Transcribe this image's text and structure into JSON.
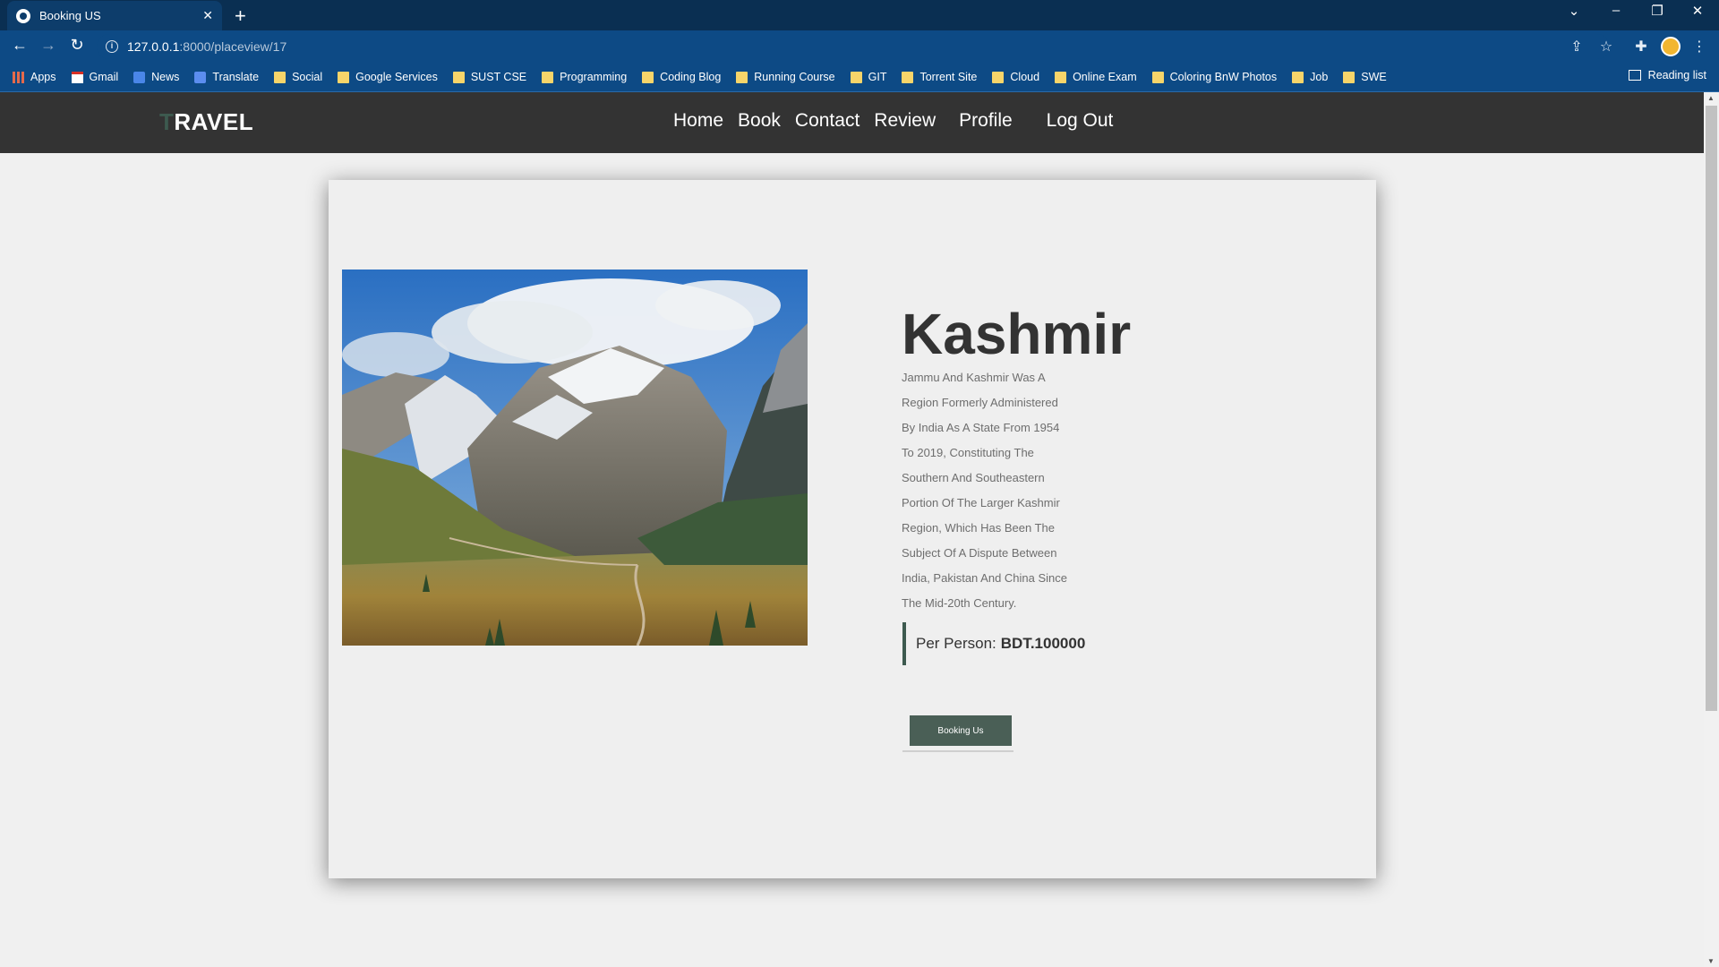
{
  "browser": {
    "tab_title": "Booking US",
    "url_host": "127.0.0.1",
    "url_path": ":8000/placeview/17",
    "bookmarks": [
      {
        "label": "Apps",
        "icon": "apps-icon"
      },
      {
        "label": "Gmail",
        "icon": "gmail-icon"
      },
      {
        "label": "News",
        "icon": "news-icon"
      },
      {
        "label": "Translate",
        "icon": "translate-icon"
      },
      {
        "label": "Social",
        "icon": "folder-icon"
      },
      {
        "label": "Google Services",
        "icon": "folder-icon"
      },
      {
        "label": "SUST CSE",
        "icon": "folder-icon"
      },
      {
        "label": "Programming",
        "icon": "folder-icon"
      },
      {
        "label": "Coding Blog",
        "icon": "folder-icon"
      },
      {
        "label": "Running Course",
        "icon": "folder-icon"
      },
      {
        "label": "GIT",
        "icon": "folder-icon"
      },
      {
        "label": "Torrent Site",
        "icon": "folder-icon"
      },
      {
        "label": "Cloud",
        "icon": "folder-icon"
      },
      {
        "label": "Online Exam",
        "icon": "folder-icon"
      },
      {
        "label": "Coloring BnW Photos",
        "icon": "folder-icon"
      },
      {
        "label": "Job",
        "icon": "folder-icon"
      },
      {
        "label": "SWE",
        "icon": "folder-icon"
      }
    ],
    "reading_list": "Reading list"
  },
  "site": {
    "logo_first": "T",
    "logo_rest": "RAVEL",
    "nav": [
      "Home",
      "Book",
      "Contact",
      "Review",
      "Profile",
      "Log Out"
    ]
  },
  "place": {
    "title": "Kashmir",
    "description_lines": [
      "Jammu And Kashmir Was A",
      "Region Formerly Administered",
      "By India As A State From 1954",
      "To 2019, Constituting The",
      "Southern And Southeastern",
      "Portion Of The Larger Kashmir",
      "Region, Which Has Been The",
      "Subject Of A Dispute Between",
      "India, Pakistan And China Since",
      "The Mid-20th Century."
    ],
    "price_label": "Per Person:",
    "price_value": "BDT.100000",
    "book_button": "Booking Us"
  },
  "colors": {
    "header_bg": "#333333",
    "accent": "#3d5a4f",
    "button": "#4a5f56",
    "chrome": "#0d4a85"
  }
}
